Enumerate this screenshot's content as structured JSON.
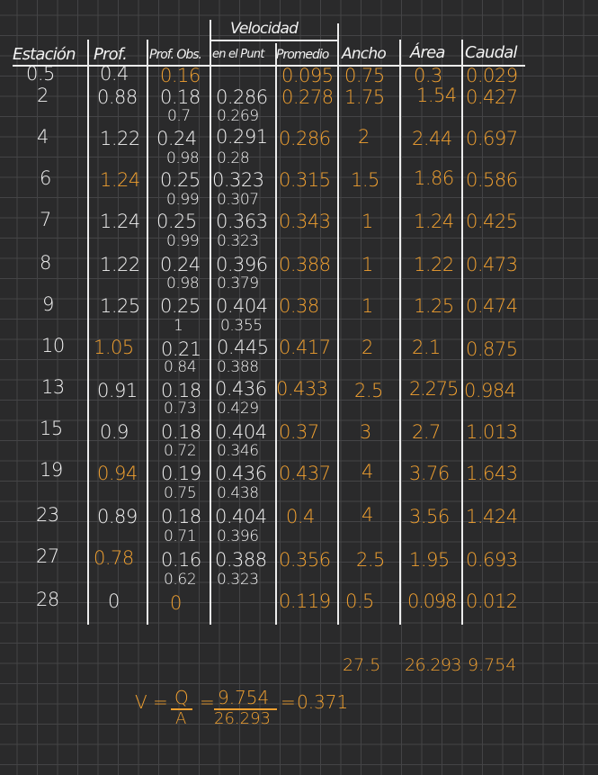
{
  "colors": {
    "ink": "#f2f2f2",
    "accent": "#f0a030",
    "paper": "#2a2a2b",
    "grid": "#444446"
  },
  "header": {
    "group_label": "Velocidad",
    "estacion": "Estación",
    "prof": "Prof.",
    "prof_obs": "Prof. Obs.",
    "en_el_punto": "en el Punt",
    "promedio": "Promedio",
    "ancho": "Ancho",
    "area": "Área",
    "caudal": "Caudal"
  },
  "rows": [
    {
      "estacion": "0.5",
      "prof": "0.4",
      "prof_obs": "0.16",
      "promedio": "0.095",
      "ancho": "0.75",
      "area": "0.3",
      "caudal": "0.029"
    },
    {
      "estacion": "2",
      "prof": "0.88",
      "prof_obs": "0.18",
      "vel": "0.286",
      "promedio": "0.278",
      "ancho": "1.75",
      "area": "1.54",
      "caudal": "0.427",
      "sub_obs": "0.7",
      "sub_vel": "0.269"
    },
    {
      "estacion": "4",
      "prof": "1.22",
      "prof_obs": "0.24",
      "vel": "0.291",
      "promedio": "0.286",
      "ancho": "2",
      "area": "2.44",
      "caudal": "0.697",
      "sub_obs": "0.98",
      "sub_vel": "0.28"
    },
    {
      "estacion": "6",
      "prof": "1.24",
      "prof_obs": "0.25",
      "vel": "0.323",
      "promedio": "0.315",
      "ancho": "1.5",
      "area": "1.86",
      "caudal": "0.586",
      "sub_obs": "0.99",
      "sub_vel": "0.307"
    },
    {
      "estacion": "7",
      "prof": "1.24",
      "prof_obs": "0.25",
      "vel": "0.363",
      "promedio": "0.343",
      "ancho": "1",
      "area": "1.24",
      "caudal": "0.425",
      "sub_obs": "0.99",
      "sub_vel": "0.323"
    },
    {
      "estacion": "8",
      "prof": "1.22",
      "prof_obs": "0.24",
      "vel": "0.396",
      "promedio": "0.388",
      "ancho": "1",
      "area": "1.22",
      "caudal": "0.473",
      "sub_obs": "0.98",
      "sub_vel": "0.379"
    },
    {
      "estacion": "9",
      "prof": "1.25",
      "prof_obs": "0.25",
      "vel": "0.404",
      "promedio": "0.38",
      "ancho": "1",
      "area": "1.25",
      "caudal": "0.474",
      "sub_obs": "1",
      "sub_vel": "0.355"
    },
    {
      "estacion": "10",
      "prof": "1.05",
      "prof_obs": "0.21",
      "vel": "0.445",
      "promedio": "0.417",
      "ancho": "2",
      "area": "2.1",
      "caudal": "0.875",
      "sub_obs": "0.84",
      "sub_vel": "0.388"
    },
    {
      "estacion": "13",
      "prof": "0.91",
      "prof_obs": "0.18",
      "vel": "0.436",
      "promedio": "0.433",
      "ancho": "2.5",
      "area": "2.275",
      "caudal": "0.984",
      "sub_obs": "0.73",
      "sub_vel": "0.429"
    },
    {
      "estacion": "15",
      "prof": "0.9",
      "prof_obs": "0.18",
      "vel": "0.404",
      "promedio": "0.37",
      "ancho": "3",
      "area": "2.7",
      "caudal": "1.013",
      "sub_obs": "0.72",
      "sub_vel": "0.346"
    },
    {
      "estacion": "19",
      "prof": "0.94",
      "prof_obs": "0.19",
      "vel": "0.436",
      "promedio": "0.437",
      "ancho": "4",
      "area": "3.76",
      "caudal": "1.643",
      "sub_obs": "0.75",
      "sub_vel": "0.438"
    },
    {
      "estacion": "23",
      "prof": "0.89",
      "prof_obs": "0.18",
      "vel": "0.404",
      "promedio": "0.4",
      "ancho": "4",
      "area": "3.56",
      "caudal": "1.424",
      "sub_obs": "0.71",
      "sub_vel": "0.396"
    },
    {
      "estacion": "27",
      "prof": "0.78",
      "prof_obs": "0.16",
      "vel": "0.388",
      "promedio": "0.356",
      "ancho": "2.5",
      "area": "1.95",
      "caudal": "0.693",
      "sub_obs": "0.62",
      "sub_vel": "0.323"
    },
    {
      "estacion": "28",
      "prof": "0",
      "prof_obs": "0",
      "promedio": "0.119",
      "ancho": "0.5",
      "area": "0.098",
      "caudal": "0.012"
    }
  ],
  "totals": {
    "ancho": "27.5",
    "area": "26.293",
    "caudal": "9.754"
  },
  "formula": {
    "lhs": "V",
    "eq1": "=",
    "q": "Q",
    "a": "A",
    "eq2": "=",
    "q_val": "9.754",
    "a_val": "26.293",
    "eq3": "=",
    "result": "0.371"
  }
}
